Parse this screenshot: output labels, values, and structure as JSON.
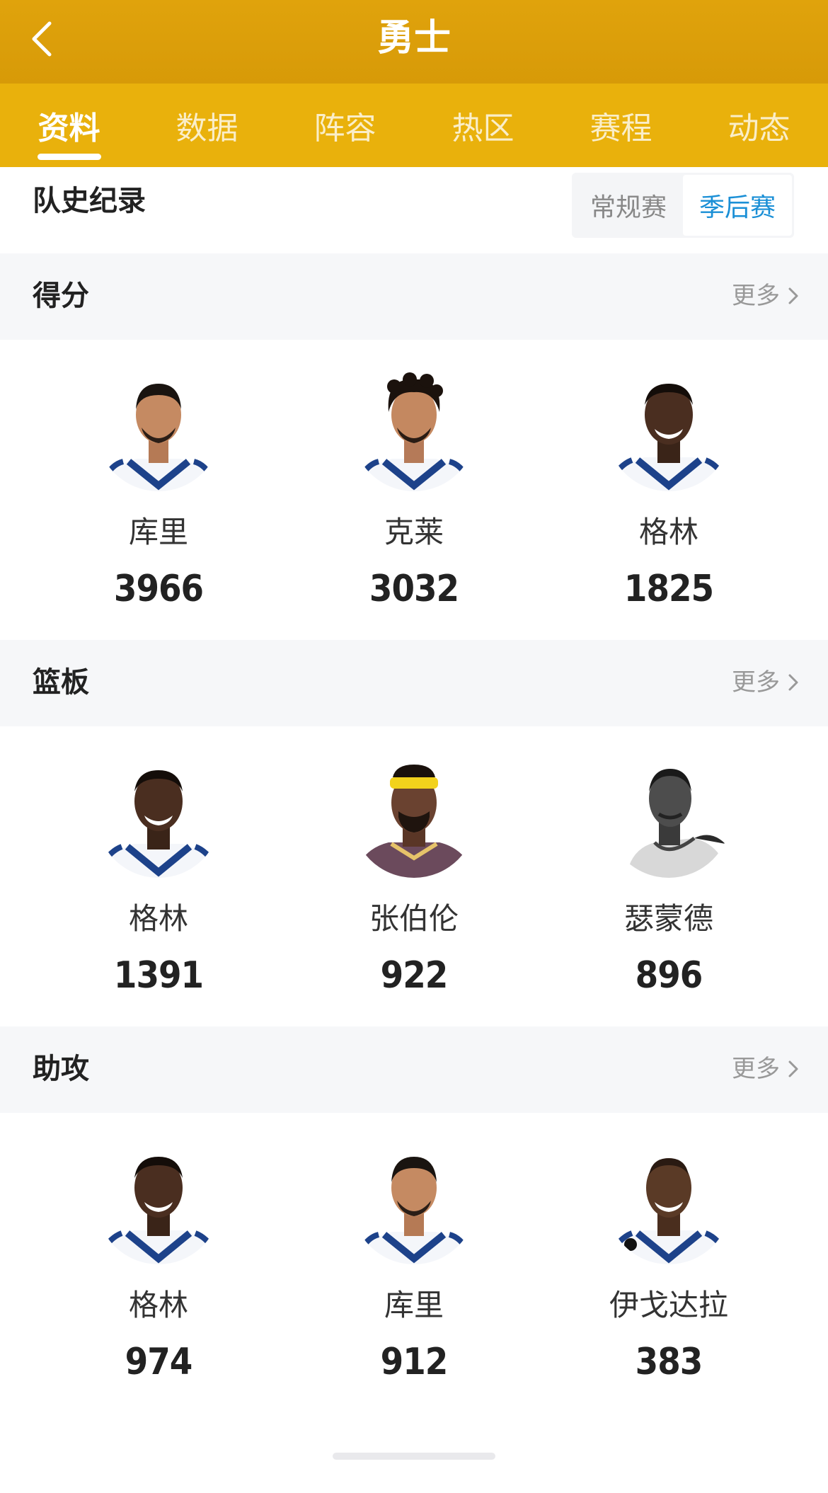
{
  "header": {
    "title": "勇士"
  },
  "tabs": [
    {
      "label": "资料",
      "active": true
    },
    {
      "label": "数据",
      "active": false
    },
    {
      "label": "阵容",
      "active": false
    },
    {
      "label": "热区",
      "active": false
    },
    {
      "label": "赛程",
      "active": false
    },
    {
      "label": "动态",
      "active": false
    }
  ],
  "history": {
    "title": "队史纪录",
    "segments": [
      {
        "label": "常规赛",
        "active": false
      },
      {
        "label": "季后赛",
        "active": true
      }
    ]
  },
  "colors": {
    "header": "#d99d09",
    "tabs": "#e9b10c",
    "accent_blue": "#1a8fd6",
    "jersey_blue": "#1d428a",
    "jersey_gold": "#ffc72c"
  },
  "sections": [
    {
      "title": "得分",
      "more_label": "更多",
      "players": [
        {
          "name": "库里",
          "value": "3966",
          "avatar": "player-photo-warriors-jersey"
        },
        {
          "name": "克莱",
          "value": "3032",
          "avatar": "player-photo-warriors-jersey"
        },
        {
          "name": "格林",
          "value": "1825",
          "avatar": "player-photo-warriors-jersey"
        }
      ]
    },
    {
      "title": "篮板",
      "more_label": "更多",
      "players": [
        {
          "name": "格林",
          "value": "1391",
          "avatar": "player-photo-warriors-jersey"
        },
        {
          "name": "张伯伦",
          "value": "922",
          "avatar": "player-photo-vintage-headband"
        },
        {
          "name": "瑟蒙德",
          "value": "896",
          "avatar": "player-photo-black-and-white"
        }
      ]
    },
    {
      "title": "助攻",
      "more_label": "更多",
      "players": [
        {
          "name": "格林",
          "value": "974",
          "avatar": "player-photo-warriors-jersey"
        },
        {
          "name": "库里",
          "value": "912",
          "avatar": "player-photo-warriors-jersey"
        },
        {
          "name": "伊戈达拉",
          "value": "383",
          "avatar": "player-photo-warriors-jersey"
        }
      ]
    }
  ]
}
